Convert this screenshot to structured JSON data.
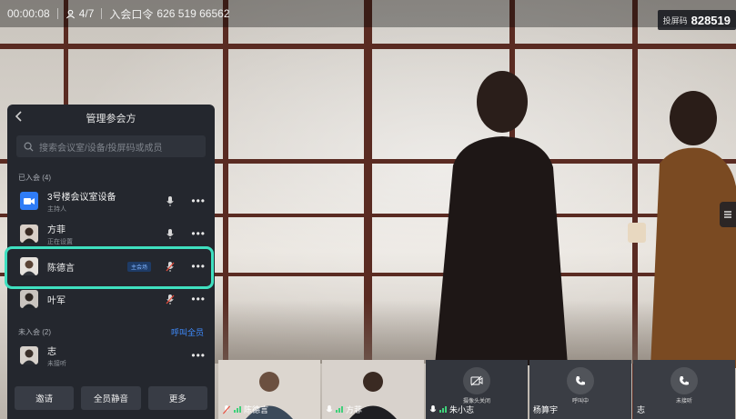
{
  "topbar": {
    "duration": "00:00:08",
    "participants": "4/7",
    "meeting_code_label": "入会口令",
    "meeting_code": "626 519 66562"
  },
  "screen_code": {
    "label": "投屏码",
    "value": "828519"
  },
  "panel": {
    "title": "管理参会方",
    "search_placeholder": "搜索会议室/设备/投屏码或成员",
    "joined_section": "已入会 (4)",
    "joined": [
      {
        "name": "3号楼会议室设备",
        "sub": "主持人",
        "avatar": "video-camera-icon",
        "mic": "on",
        "tag": ""
      },
      {
        "name": "方菲",
        "sub": "正在设置",
        "avatar": "user-photo",
        "mic": "on",
        "tag": ""
      },
      {
        "name": "陈德言",
        "sub": "",
        "avatar": "user-photo",
        "mic": "muted",
        "tag": "主会场"
      },
      {
        "name": "叶军",
        "sub": "",
        "avatar": "user-photo",
        "mic": "muted",
        "tag": ""
      }
    ],
    "not_joined_section": "未入会 (2)",
    "call_all": "呼叫全员",
    "not_joined": [
      {
        "name": "志",
        "sub": "未接听",
        "avatar": "user-photo"
      }
    ],
    "buttons": {
      "invite": "邀请",
      "mute_all": "全员静音",
      "more": "更多"
    }
  },
  "thumbnails": [
    {
      "name": "陈德言",
      "type": "video",
      "bg": "#dcd6cf"
    },
    {
      "name": "方菲",
      "type": "video",
      "bg": "#d8d2cc"
    },
    {
      "name": "朱小志",
      "type": "camera-off",
      "status": "摄像头关闭",
      "bg": "#33363d"
    },
    {
      "name": "杨算宇",
      "type": "calling",
      "status": "呼叫中",
      "bg": "#3a3d44"
    },
    {
      "name": "志",
      "type": "calling",
      "status": "未接听",
      "bg": "#3a3d44"
    }
  ],
  "colors": {
    "accent": "#3f8cff",
    "highlight": "#3fe0c0",
    "panel": "#24272e"
  }
}
